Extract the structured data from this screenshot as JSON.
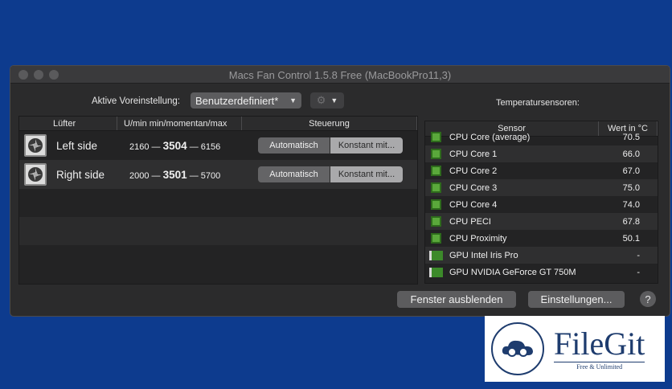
{
  "window": {
    "title": "Macs Fan Control 1.5.8 Free (MacBookPro11,3)"
  },
  "preset": {
    "label": "Aktive Voreinstellung:",
    "selected": "Benutzerdefiniert*"
  },
  "temperature_section": {
    "label": "Temperatursensoren:"
  },
  "fans": {
    "headers": {
      "name": "Lüfter",
      "speed": "U/min min/momentan/max",
      "control": "Steuerung"
    },
    "rows": [
      {
        "name": "Left side",
        "min": "2160",
        "current": "3504",
        "max": "6156",
        "auto_label": "Automatisch",
        "constant_label": "Konstant mit..."
      },
      {
        "name": "Right side",
        "min": "2000",
        "current": "3501",
        "max": "5700",
        "auto_label": "Automatisch",
        "constant_label": "Konstant mit..."
      }
    ]
  },
  "sensors": {
    "headers": {
      "name": "Sensor",
      "value": "Wert in °C"
    },
    "rows": [
      {
        "name": "CPU Core (average)",
        "value": "70.5",
        "icon": "cpu-chip-icon"
      },
      {
        "name": "CPU Core 1",
        "value": "66.0",
        "icon": "cpu-chip-icon"
      },
      {
        "name": "CPU Core 2",
        "value": "67.0",
        "icon": "cpu-chip-icon"
      },
      {
        "name": "CPU Core 3",
        "value": "75.0",
        "icon": "cpu-chip-icon"
      },
      {
        "name": "CPU Core 4",
        "value": "74.0",
        "icon": "cpu-chip-icon"
      },
      {
        "name": "CPU PECI",
        "value": "67.8",
        "icon": "cpu-chip-icon"
      },
      {
        "name": "CPU Proximity",
        "value": "50.1",
        "icon": "cpu-chip-icon"
      },
      {
        "name": "GPU Intel Iris Pro",
        "value": "-",
        "icon": "gpu-card-icon"
      },
      {
        "name": "GPU NVIDIA GeForce GT 750M",
        "value": "-",
        "icon": "gpu-card-icon"
      }
    ]
  },
  "buttons": {
    "hide": "Fenster ausblenden",
    "settings": "Einstellungen...",
    "help": "?"
  },
  "watermark": {
    "name": "FileGit",
    "tagline": "Free & Unlimited"
  },
  "colors": {
    "desktop": "#0d3b8e",
    "window": "#2b2b2c",
    "chip": "#5aa83b"
  }
}
